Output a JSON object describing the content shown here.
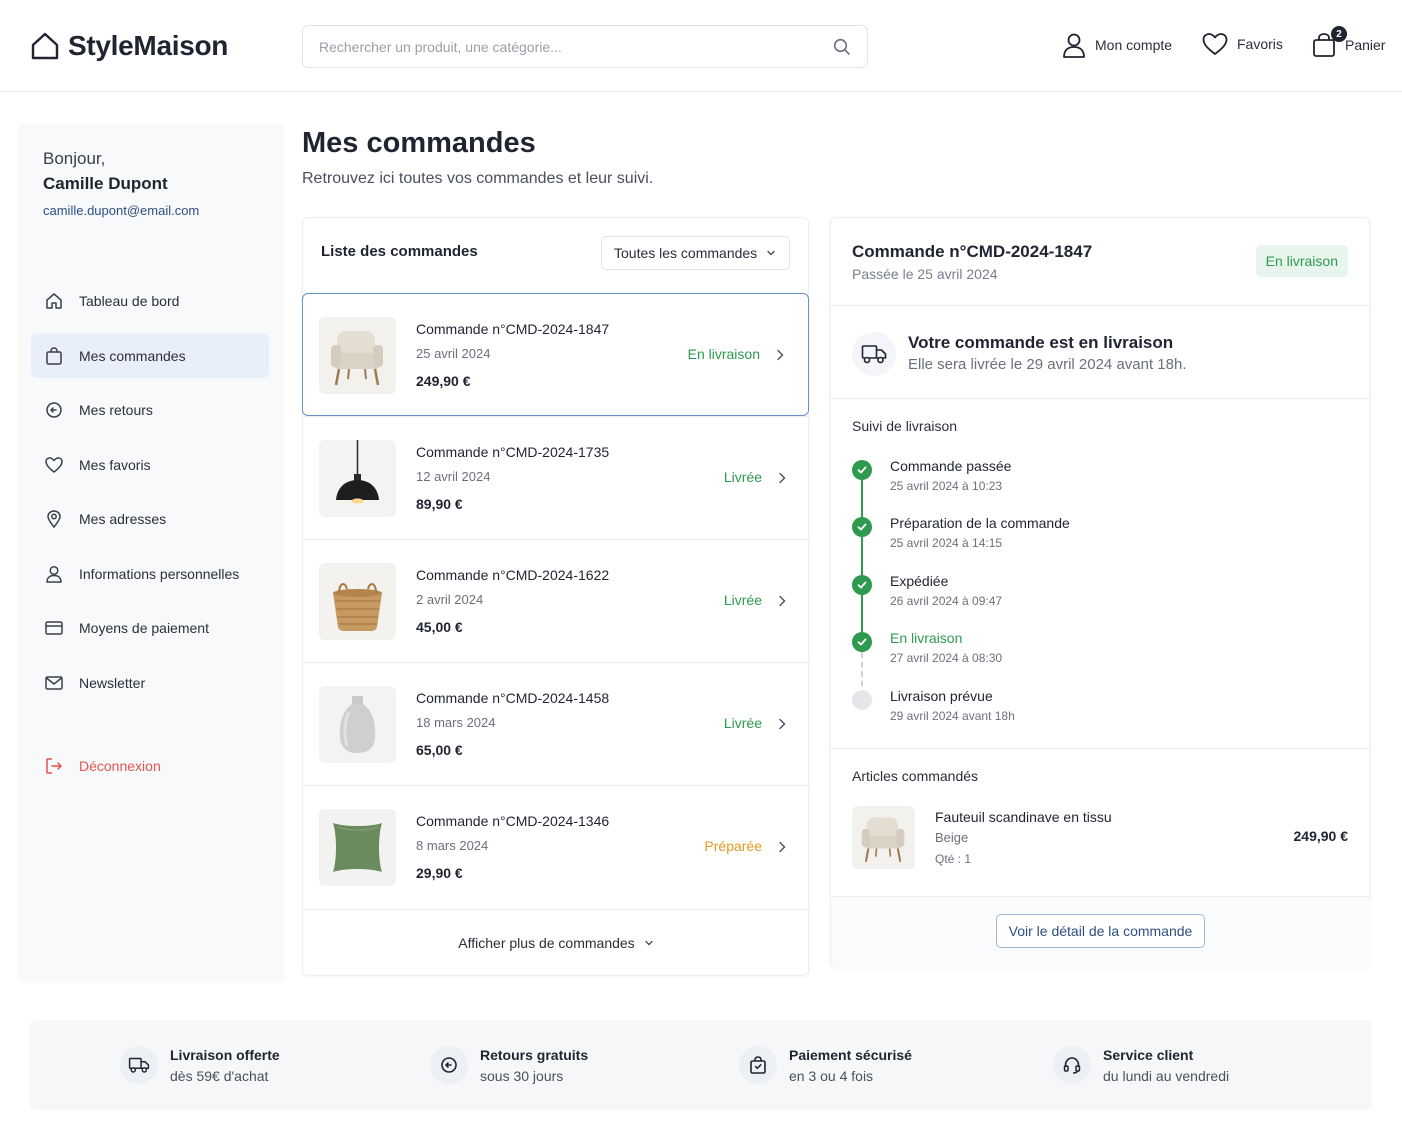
{
  "header": {
    "logo": "StyleMaison",
    "search_placeholder": "Rechercher un produit, une catégorie...",
    "account_label": "Mon compte",
    "favorites_label": "Favoris",
    "cart_label": "Panier",
    "cart_count": "2"
  },
  "sidebar": {
    "greeting": "Bonjour,",
    "user_name": "Camille Dupont",
    "user_email": "camille.dupont@email.com",
    "items": [
      {
        "label": "Tableau de bord",
        "icon": "home-icon"
      },
      {
        "label": "Mes commandes",
        "icon": "shopping-bag-icon",
        "active": true
      },
      {
        "label": "Mes retours",
        "icon": "return-icon"
      },
      {
        "label": "Mes favoris",
        "icon": "heart-icon"
      },
      {
        "label": "Mes adresses",
        "icon": "map-pin-icon"
      },
      {
        "label": "Informations personnelles",
        "icon": "user-icon"
      },
      {
        "label": "Moyens de paiement",
        "icon": "credit-card-icon"
      },
      {
        "label": "Newsletter",
        "icon": "mail-icon"
      }
    ],
    "logout_label": "Déconnexion"
  },
  "page": {
    "title": "Mes commandes",
    "subtitle": "Retrouvez ici toutes vos commandes et leur suivi."
  },
  "orders_list": {
    "title": "Liste des commandes",
    "filter_value": "Toutes les commandes",
    "orders": [
      {
        "number": "Commande n°CMD-2024-1847",
        "date": "25 avril 2024",
        "price": "249,90 €",
        "status": "En livraison",
        "status_color": "#2e9a4f",
        "product": "armchair"
      },
      {
        "number": "Commande n°CMD-2024-1735",
        "date": "12 avril 2024",
        "price": "89,90 €",
        "status": "Livrée",
        "status_color": "#2e9a4f",
        "product": "pendant-lamp"
      },
      {
        "number": "Commande n°CMD-2024-1622",
        "date": "2 avril 2024",
        "price": "45,00 €",
        "status": "Livrée",
        "status_color": "#2e9a4f",
        "product": "basket"
      },
      {
        "number": "Commande n°CMD-2024-1458",
        "date": "18 mars 2024",
        "price": "65,00 €",
        "status": "Livrée",
        "status_color": "#2e9a4f",
        "product": "vase"
      },
      {
        "number": "Commande n°CMD-2024-1346",
        "date": "8 mars 2024",
        "price": "29,90 €",
        "status": "Préparée",
        "status_color": "#e59a20",
        "product": "cushion"
      }
    ],
    "more_label": "Afficher plus de commandes"
  },
  "order_detail": {
    "title": "Commande n°CMD-2024-1847",
    "date": "Passée le 25 avril 2024",
    "badge": "En livraison",
    "shipping_title": "Votre commande est en livraison",
    "shipping_sub": "Elle sera livrée le 29 avril 2024 avant 18h.",
    "tracking_title": "Suivi de livraison",
    "tracking": [
      {
        "label": "Commande passée",
        "time": "25 avril 2024 à 10:23",
        "done": true
      },
      {
        "label": "Préparation de la commande",
        "time": "25 avril 2024 à 14:15",
        "done": true
      },
      {
        "label": "Expédiée",
        "time": "26 avril 2024 à 09:47",
        "done": true
      },
      {
        "label": "En livraison",
        "time": "27 avril 2024 à 08:30",
        "done": true,
        "current": true
      },
      {
        "label": "Livraison prévue",
        "time": "29 avril 2024 avant 18h",
        "done": false
      }
    ],
    "items_title": "Articles commandés",
    "item": {
      "name": "Fauteuil scandinave en tissu",
      "variant": "Beige",
      "qty": "Qté : 1",
      "price": "249,90 €"
    },
    "detail_button": "Voir le détail de la commande"
  },
  "features": [
    {
      "title": "Livraison offerte",
      "sub": "dès 59€ d'achat",
      "icon": "truck-icon"
    },
    {
      "title": "Retours gratuits",
      "sub": "sous 30 jours",
      "icon": "return-icon"
    },
    {
      "title": "Paiement sécurisé",
      "sub": "en 3 ou 4 fois",
      "icon": "secure-bag-icon"
    },
    {
      "title": "Service client",
      "sub": "du lundi au vendredi",
      "icon": "headset-icon"
    }
  ]
}
